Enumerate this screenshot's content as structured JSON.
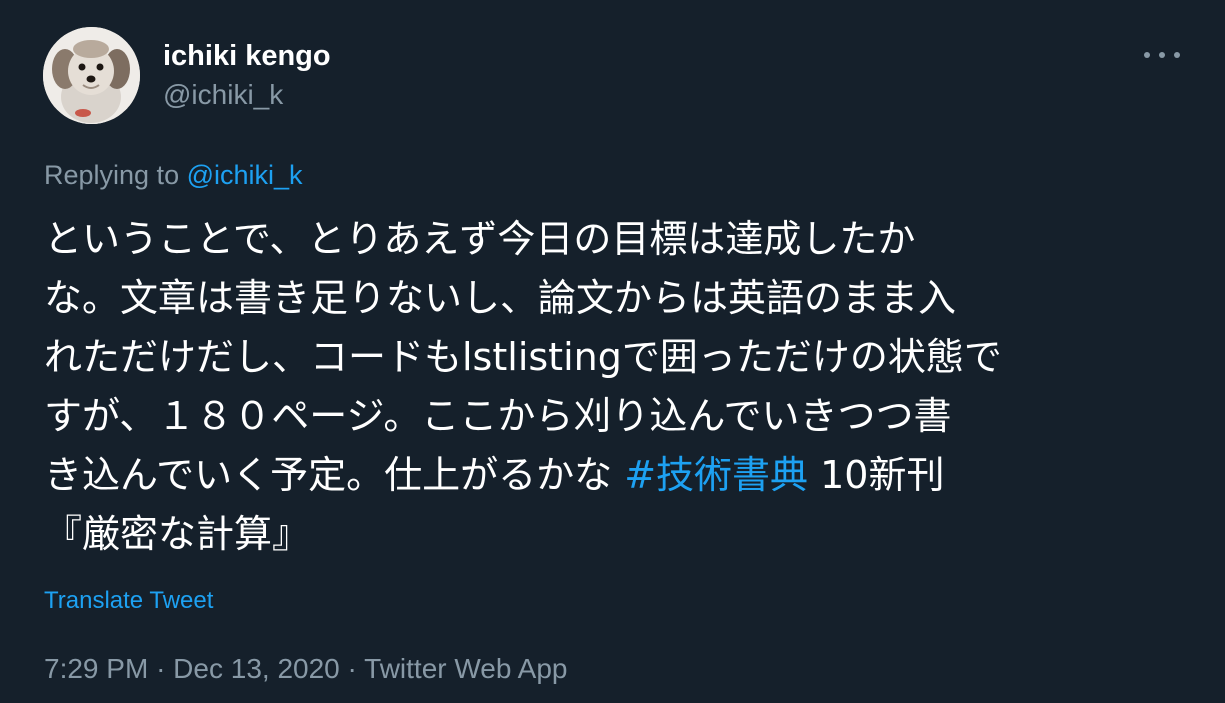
{
  "author": {
    "display_name": "ichiki kengo",
    "handle": "@ichiki_k"
  },
  "reply": {
    "prefix": "Replying to",
    "mention": "@ichiki_k"
  },
  "tweet": {
    "lines": [
      {
        "text": "ということで、とりあえず今日の目標は達成したか"
      },
      {
        "text": "な。文章は書き足りないし、論文からは英語のまま入"
      },
      {
        "text": "れただけだし、コードもlstlistingで囲っただけの状態で"
      },
      {
        "text": "すが、１８０ページ。ここから刈り込んでいきつつ書"
      },
      {
        "before": "き込んでいく予定。仕上がるかな ",
        "hashtag": "#技術書典",
        "after": " 10新刊"
      },
      {
        "text": "『厳密な計算』"
      }
    ]
  },
  "translate_label": "Translate Tweet",
  "meta": {
    "time": "7:29 PM",
    "separator": "·",
    "date": "Dec 13, 2020",
    "source": "Twitter Web App"
  },
  "colors": {
    "background": "#15202b",
    "text": "#ffffff",
    "secondary": "#8899a6",
    "accent": "#1da1f2"
  },
  "icons": {
    "more": "more-horizontal-icon"
  }
}
